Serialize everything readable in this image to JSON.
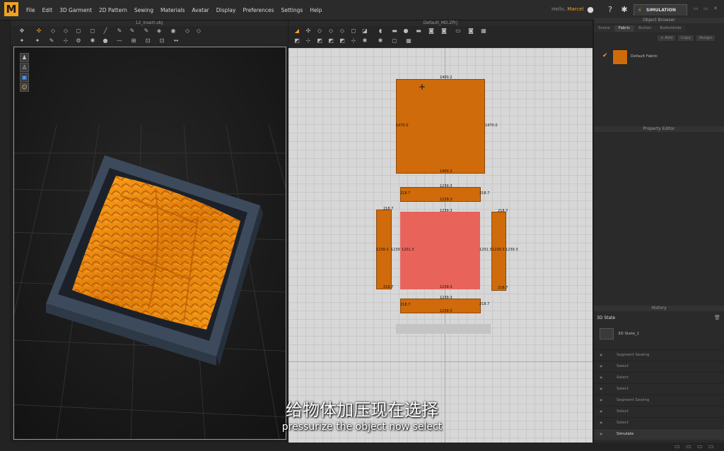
{
  "menu": {
    "logo": "M",
    "items": [
      "File",
      "Edit",
      "3D Garment",
      "2D Pattern",
      "Sewing",
      "Materials",
      "Avatar",
      "Display",
      "Preferences",
      "Settings",
      "Help"
    ],
    "user_prefix": "Hello,",
    "user_name": "Marcel",
    "simulation_label": "SIMULATION"
  },
  "panel3d": {
    "title": "12_insert.obj"
  },
  "panel2d": {
    "title": "Default_MD.ZPrj",
    "pieces": {
      "top_top": "1400.2",
      "top_left": "1470.0",
      "top_right": "1470.0",
      "top_bottom": "1400.2",
      "strip1_top": "1239.3",
      "strip1_left": "218.7",
      "strip1_right": "218.7",
      "strip1_bottom": "1239.3",
      "left_top": "218.7",
      "left_left": "1239.3",
      "left_right": "1239.3",
      "left_bottom": "218.7",
      "center_top": "1239.3",
      "center_left": "1201.3",
      "center_right": "1201.3",
      "center_bottom": "1239.3",
      "right_top": "218.7",
      "right_left": "1239.3",
      "right_right": "1239.3",
      "right_bottom": "218.7",
      "strip2_top": "1239.3",
      "strip2_left": "218.7",
      "strip2_right": "218.7",
      "strip2_bottom": "1239.3"
    }
  },
  "right_panel": {
    "object_browser_title": "Object Browser",
    "tabs": [
      "Scene",
      "Fabric",
      "Button",
      "Buttonhole"
    ],
    "active_tab": "Fabric",
    "add_label": "+ Add",
    "copy_label": "Copy",
    "assign_label": "Assign",
    "fabric_name": "Default Fabric",
    "fabric_color": "#cf6b0a",
    "property_editor_title": "Property Editor",
    "history_title": "History",
    "state_header": "3D State",
    "state_item": "3D State_1",
    "history_items": [
      "Segment Sewing",
      "Select",
      "Select",
      "Select",
      "Segment Sewing",
      "Select",
      "Select",
      "Simulate"
    ]
  },
  "subtitles": {
    "chinese": "给物体加压现在选择",
    "english": "pressurize the object now select"
  }
}
